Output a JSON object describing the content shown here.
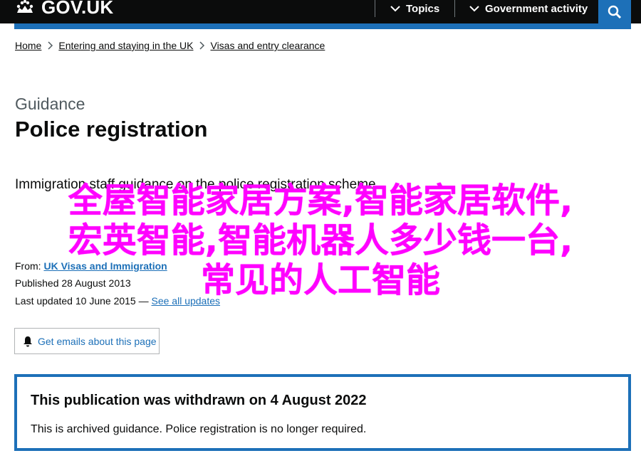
{
  "header": {
    "logo_text": "GOV.UK",
    "nav": [
      {
        "label": "Topics",
        "icon": "chevron-down-icon"
      },
      {
        "label": "Government activity",
        "icon": "chevron-down-icon"
      }
    ],
    "search_icon": "search-icon"
  },
  "breadcrumbs": [
    "Home",
    "Entering and staying in the UK",
    "Visas and entry clearance"
  ],
  "page": {
    "caption": "Guidance",
    "title": "Police registration",
    "summary": "Immigration staff guidance on the police registration scheme."
  },
  "overlay": {
    "lines": [
      "全屋智能家居方案,智能家居软件,",
      "宏英智能,智能机器人多少钱一台,",
      "常见的人工智能"
    ]
  },
  "meta": {
    "from_label": "From:",
    "from_link": "UK Visas and Immigration",
    "published_label": "Published",
    "published_date": "28 August 2013",
    "updated_label": "Last updated",
    "updated_date": "10 June 2015 —",
    "updates_link": "See all updates"
  },
  "email_button": {
    "label": "Get emails about this page",
    "icon": "bell-icon"
  },
  "withdrawn": {
    "title": "This publication was withdrawn on 4 August 2022",
    "text": "This is archived guidance. Police registration is no longer required."
  },
  "colors": {
    "header_bg": "#0b0c0c",
    "accent_blue": "#1d70b8",
    "overlay_magenta": "#ff00ff",
    "secondary_text": "#505a5f"
  }
}
